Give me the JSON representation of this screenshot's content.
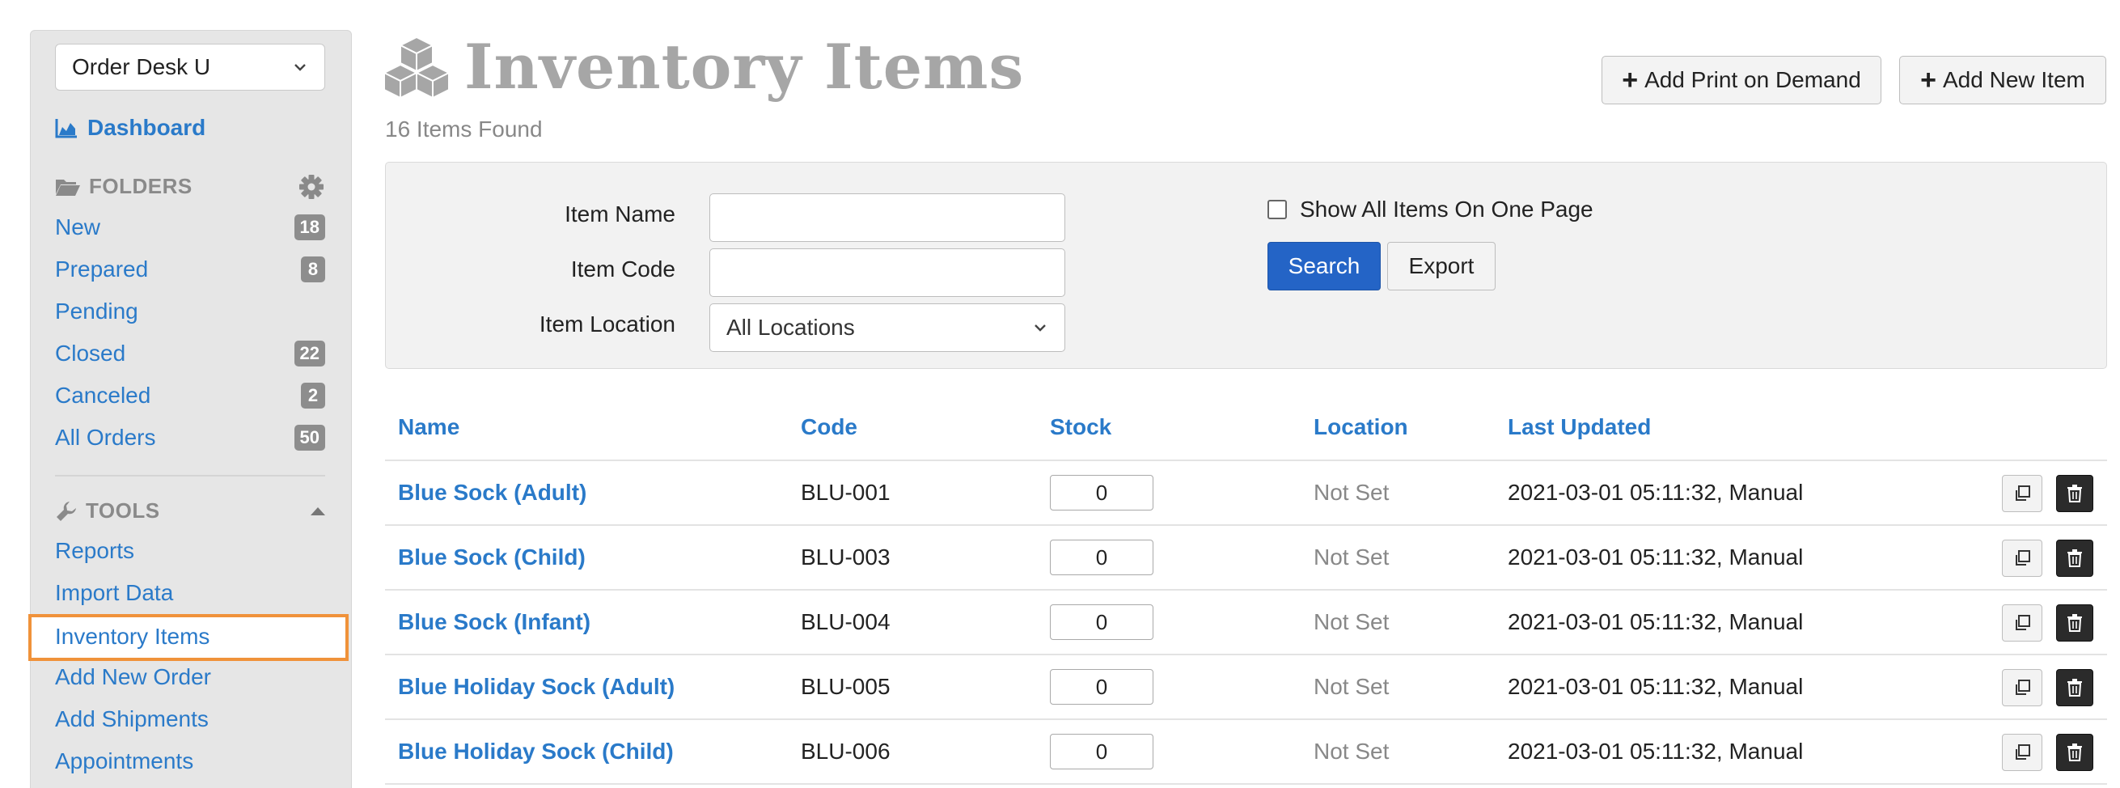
{
  "sidebar": {
    "store_select": "Order Desk U",
    "dashboard": "Dashboard",
    "folders_heading": "FOLDERS",
    "folders": [
      {
        "label": "New",
        "count": "18"
      },
      {
        "label": "Prepared",
        "count": "8"
      },
      {
        "label": "Pending",
        "count": ""
      },
      {
        "label": "Closed",
        "count": "22"
      },
      {
        "label": "Canceled",
        "count": "2"
      },
      {
        "label": "All Orders",
        "count": "50"
      }
    ],
    "tools_heading": "TOOLS",
    "tools": [
      {
        "label": "Reports"
      },
      {
        "label": "Import Data"
      },
      {
        "label": "Inventory Items"
      },
      {
        "label": "Add New Order"
      },
      {
        "label": "Add Shipments"
      },
      {
        "label": "Appointments"
      }
    ],
    "active_tool": "Inventory Items"
  },
  "header": {
    "title": "Inventory Items",
    "items_found": "16 Items Found",
    "add_print_on_demand": "Add Print on Demand",
    "add_new_item": "Add New Item"
  },
  "filters": {
    "item_name_label": "Item Name",
    "item_name_value": "",
    "item_code_label": "Item Code",
    "item_code_value": "",
    "item_location_label": "Item Location",
    "item_location_value": "All Locations",
    "show_all_label": "Show All Items On One Page",
    "show_all_checked": false,
    "search_button": "Search",
    "export_button": "Export"
  },
  "table": {
    "columns": [
      "Name",
      "Code",
      "Stock",
      "Location",
      "Last Updated"
    ],
    "rows": [
      {
        "name": "Blue Sock (Adult)",
        "code": "BLU-001",
        "stock": "0",
        "location": "Not Set",
        "updated": "2021-03-01 05:11:32, Manual"
      },
      {
        "name": "Blue Sock (Child)",
        "code": "BLU-003",
        "stock": "0",
        "location": "Not Set",
        "updated": "2021-03-01 05:11:32, Manual"
      },
      {
        "name": "Blue Sock (Infant)",
        "code": "BLU-004",
        "stock": "0",
        "location": "Not Set",
        "updated": "2021-03-01 05:11:32, Manual"
      },
      {
        "name": "Blue Holiday Sock (Adult)",
        "code": "BLU-005",
        "stock": "0",
        "location": "Not Set",
        "updated": "2021-03-01 05:11:32, Manual"
      },
      {
        "name": "Blue Holiday Sock (Child)",
        "code": "BLU-006",
        "stock": "0",
        "location": "Not Set",
        "updated": "2021-03-01 05:11:32, Manual"
      }
    ]
  },
  "colors": {
    "link": "#2a7ac9",
    "primary_button": "#2464c6",
    "active_highlight": "#f0923a",
    "badge": "#8d8d8d",
    "delete_button": "#2b2b2b"
  }
}
